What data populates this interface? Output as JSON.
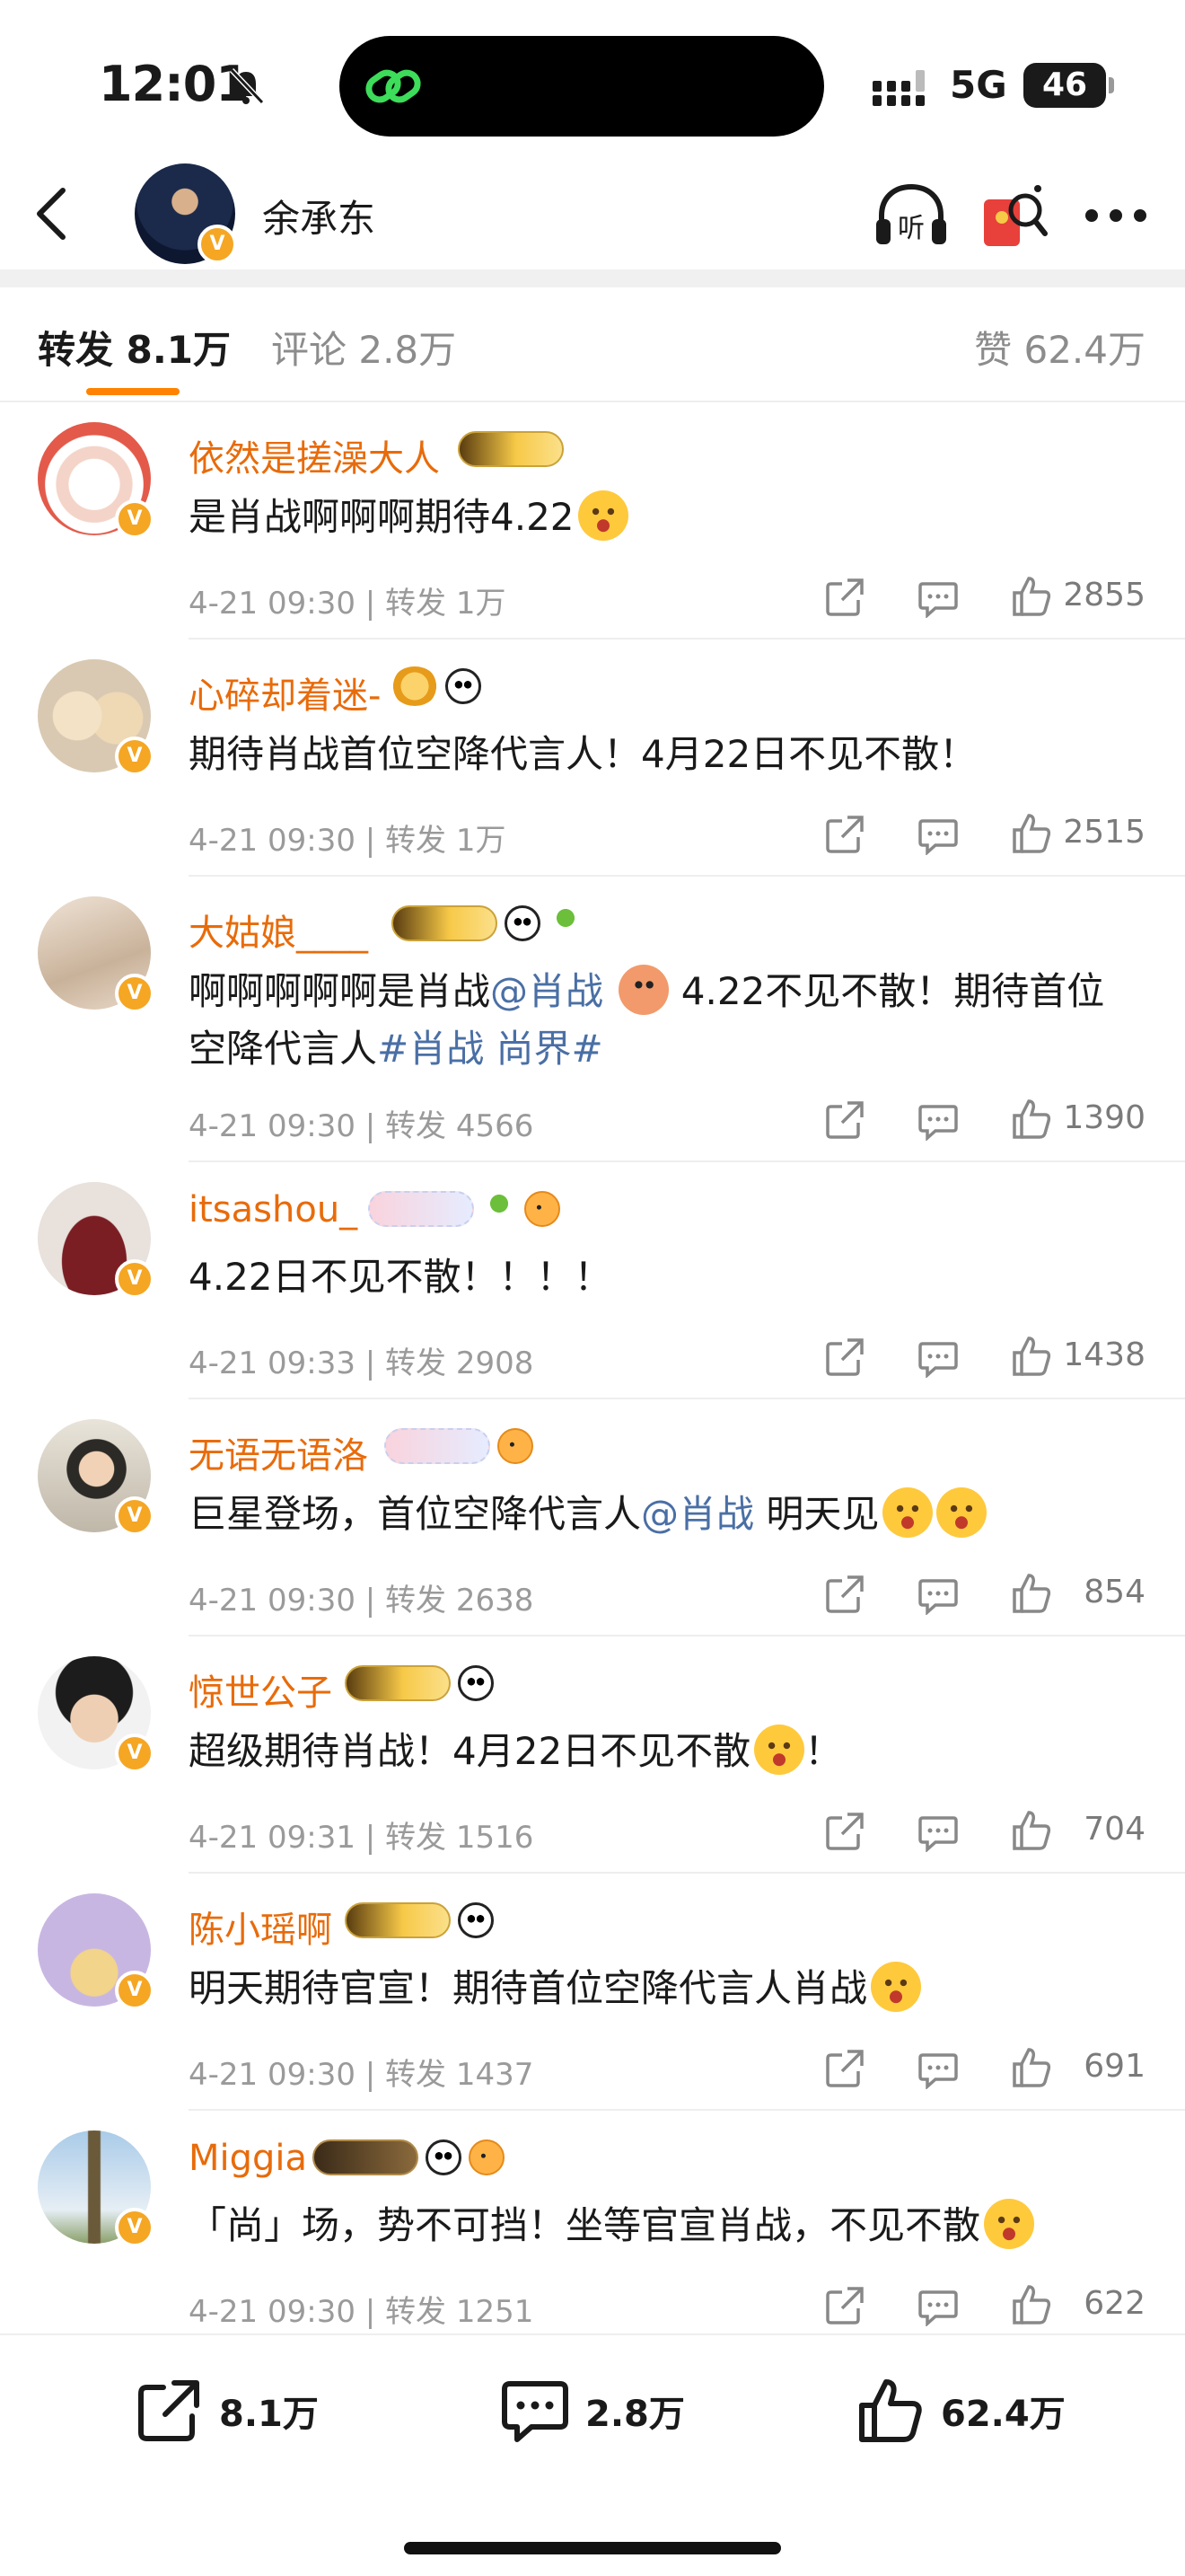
{
  "status_bar": {
    "time": "12:01",
    "network": "5G",
    "battery": "46"
  },
  "header": {
    "author_name": "余承东"
  },
  "tabs": {
    "repost_label": "转发 8.1万",
    "comment_label": "评论 2.8万",
    "like_label": "赞 62.4万",
    "active": "转发"
  },
  "colors": {
    "accent": "#ff8200",
    "username": "#e86b0a",
    "mention": "#4a6fa5"
  },
  "comments": [
    {
      "username": "依然是搓澡大人",
      "text": "是肖战啊啊啊期待4.22",
      "date": "4-21 09:30",
      "repost": "转发 1万",
      "likes": "2855"
    },
    {
      "username": "心碎却着迷-",
      "text": "期待肖战首位空降代言人！4月22日不见不散！",
      "date": "4-21 09:30",
      "repost": "转发 1万",
      "likes": "2515"
    },
    {
      "username": "大姑娘____",
      "text_before": "啊啊啊啊啊是肖战",
      "mention": "@肖战",
      "text_mid": "4.22不见不散！期待首位空降代言人",
      "hashtag": "#肖战 尚界#",
      "date": "4-21 09:30",
      "repost": "转发 4566",
      "likes": "1390"
    },
    {
      "username": "itsashou_",
      "text": "4.22日不见不散！！！！",
      "date": "4-21 09:33",
      "repost": "转发 2908",
      "likes": "1438"
    },
    {
      "username": "无语无语洛",
      "text_before": "巨星登场，首位空降代言人",
      "mention": "@肖战",
      "text_after": "明天见",
      "date": "4-21 09:30",
      "repost": "转发 2638",
      "likes": "854"
    },
    {
      "username": "惊世公子",
      "text": "超级期待肖战！4月22日不见不散",
      "text_after": "！",
      "date": "4-21 09:31",
      "repost": "转发 1516",
      "likes": "704"
    },
    {
      "username": "陈小瑶啊",
      "text": "明天期待官宣！期待首位空降代言人肖战",
      "date": "4-21 09:30",
      "repost": "转发 1437",
      "likes": "691"
    },
    {
      "username": "Miggia",
      "text": "「尚」场，势不可挡！坐等官宣肖战，不见不散",
      "date": "4-21 09:30",
      "repost": "转发 1251",
      "likes": "622"
    }
  ],
  "bottom_bar": {
    "repost_count": "8.1万",
    "comment_count": "2.8万",
    "like_count": "62.4万"
  }
}
